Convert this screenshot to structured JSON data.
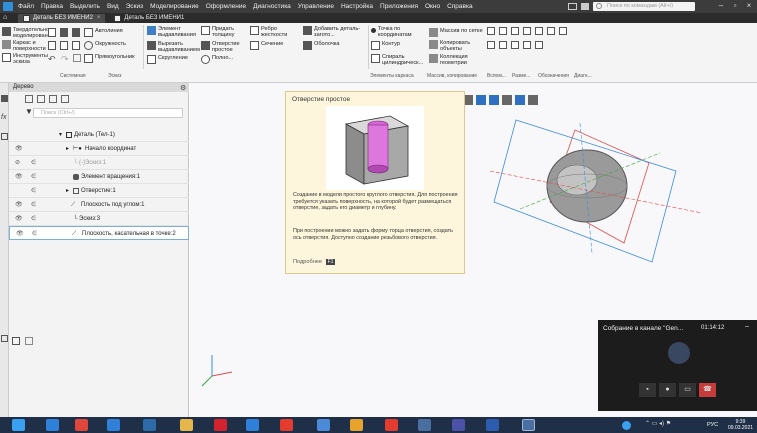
{
  "menubar": {
    "items": [
      "Файл",
      "Правка",
      "Выделить",
      "Вид",
      "Эскиз",
      "Моделирование",
      "Оформление",
      "Диагностика",
      "Управление",
      "Настройка",
      "Приложения",
      "Окно",
      "Справка"
    ],
    "search_placeholder": "Поиск по командам (Alt+/)"
  },
  "tabs": [
    {
      "label": "Деталь БЕЗ ИМЕНИ2"
    },
    {
      "label": "Деталь БЕЗ ИМЕНИ1"
    }
  ],
  "ribbon": {
    "left_tools": [
      "Твердотельное моделирование",
      "Каркас и поверхности",
      "Инструменты эскиза"
    ],
    "sketch_tools": [
      "Автолиния",
      "Окружность",
      "Прямоугольник"
    ],
    "ops_1": [
      "Элемент выдавливания",
      "Вырезать выдавливанием",
      "Скругление"
    ],
    "ops_2": [
      "Придать толщину",
      "Отверстие простое",
      "Полно..."
    ],
    "ops_3": [
      "Ребро жесткости",
      "Сечение"
    ],
    "ops_4": [
      "Добавить деталь-загото...",
      "Оболочка"
    ],
    "ops_5": [
      "Точка по координатам",
      "Контур",
      "Спираль цилиндрическ..."
    ],
    "ops_6": [
      "Массив по сетке",
      "Копировать объекты",
      "Коллекция геометрии"
    ],
    "group_labels": [
      "Системная",
      "Эскиз",
      "Элементы каркаса",
      "Массив, копирование",
      "Вспом...",
      "Разме...",
      "Обозначения",
      "Диагн..."
    ]
  },
  "tree": {
    "header": "Дерево",
    "search_placeholder": "Поиск (Ctrl+/)",
    "rows": [
      {
        "label": "Деталь (Тел-1)"
      },
      {
        "label": "Начало координат"
      },
      {
        "label": "(-)Эскиз:1"
      },
      {
        "label": "Элемент вращения:1"
      },
      {
        "label": "Отверстие:1"
      },
      {
        "label": "Плоскость под углом:1"
      },
      {
        "label": "Эскиз:3"
      },
      {
        "label": "Плоскость, касательная в точке:2"
      }
    ]
  },
  "tooltip": {
    "title": "Отверстие простое",
    "para1": "Создание в модели простого круглого отверстия. Для построения требуется указать поверхность, на которой будет размещаться отверстие, задать его диаметр и глубину.",
    "para2": "При построении можно задать форму торца отверстия, создать ось отверстия. Доступно создание резьбового отверстия.",
    "more": "Подробнее",
    "key": "F1"
  },
  "meeting": {
    "title": "Собрание в канале \"Gen...",
    "time": "01:14:12"
  },
  "taskbar": {
    "lang": "РУС",
    "time": "9:39",
    "date": "09.03.2021"
  }
}
